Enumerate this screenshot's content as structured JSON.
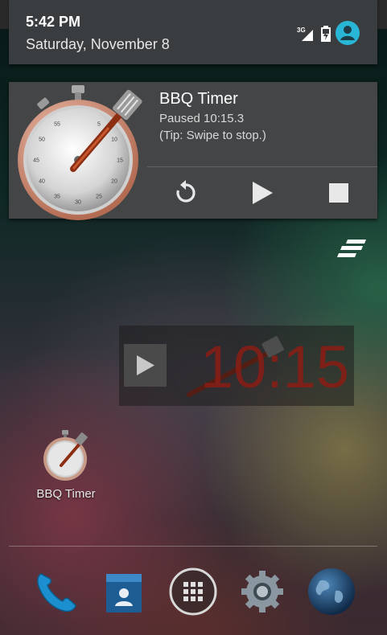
{
  "status_bar": {
    "time": "5:42 PM",
    "date": "Saturday, November 8",
    "network_label": "3G",
    "icons": [
      "signal-icon",
      "battery-icon",
      "profile-icon"
    ]
  },
  "notification": {
    "title": "BBQ Timer",
    "status": "Paused 10:15.3",
    "tip": "(Tip: Swipe to stop.)",
    "stopwatch_numbers": [
      "55",
      "5",
      "50",
      "10",
      "45",
      "15",
      "40",
      "20",
      "35",
      "25",
      "30"
    ],
    "actions": [
      "reset-icon",
      "play-icon",
      "stop-icon"
    ]
  },
  "widget": {
    "time": "10:15"
  },
  "home": {
    "app_label": "BBQ Timer"
  },
  "dock": {
    "items": [
      "phone-icon",
      "contacts-icon",
      "apps-icon",
      "settings-icon",
      "browser-icon"
    ]
  },
  "colors": {
    "accent": "#29b6d6",
    "widget_time": "#8a1d15",
    "card_bg": "#434547"
  }
}
